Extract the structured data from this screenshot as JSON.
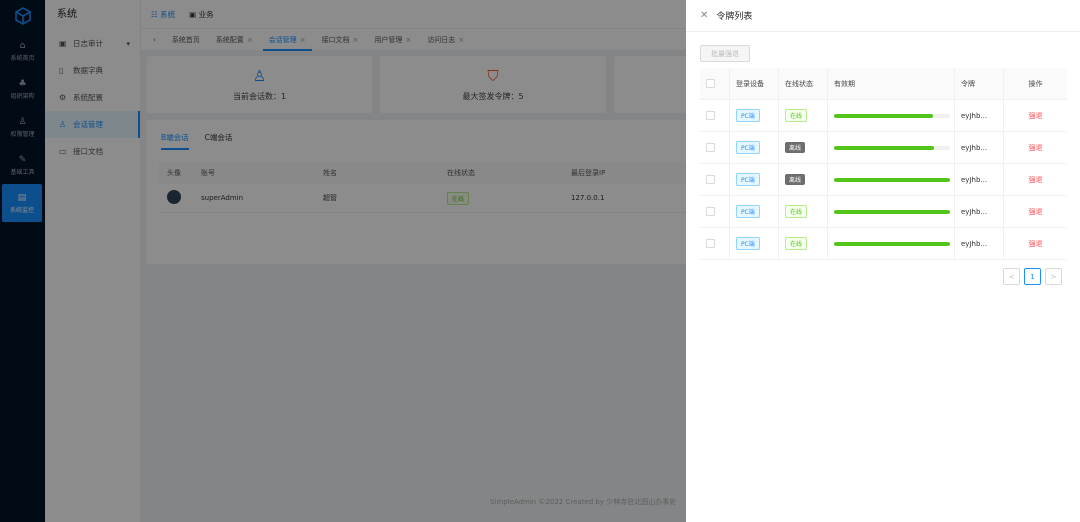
{
  "rail": {
    "items": [
      {
        "label": "系统首页"
      },
      {
        "label": "组织架构"
      },
      {
        "label": "权限管理"
      },
      {
        "label": "基础工具"
      },
      {
        "label": "系统监控"
      }
    ]
  },
  "sidebar": {
    "title": "系统",
    "items": [
      {
        "label": "日志审计"
      },
      {
        "label": "数据字典"
      },
      {
        "label": "系统配置"
      },
      {
        "label": "会话管理"
      },
      {
        "label": "接口文档"
      }
    ]
  },
  "header": {
    "link1": "系统",
    "link2": "业务"
  },
  "tabs": [
    {
      "label": "系统首页"
    },
    {
      "label": "系统配置"
    },
    {
      "label": "会话管理"
    },
    {
      "label": "接口文档"
    },
    {
      "label": "用户管理"
    },
    {
      "label": "访问日志"
    }
  ],
  "cards": {
    "sessions": "当前会话数：1",
    "max_tokens": "最大签发令牌：5"
  },
  "session_tabs": {
    "b": "B端会话",
    "c": "C端会话"
  },
  "session_table": {
    "headers": [
      "头像",
      "账号",
      "姓名",
      "在线状态",
      "最后登录IP"
    ],
    "row": {
      "account": "superAdmin",
      "name": "超管",
      "status": "在线",
      "ip": "127.0.0.1"
    }
  },
  "footer": "SimpleAdmin ©2022 Created by 少林寺驻北固山办事处",
  "drawer": {
    "title": "令牌列表",
    "batch_button": "批量强退",
    "headers": [
      "登录设备",
      "在线状态",
      "有效期",
      "令牌",
      "操作"
    ],
    "rows": [
      {
        "device": "PC端",
        "status": "在线",
        "online": true,
        "validity": 0.85,
        "token": "eyJhb...",
        "action": "强退"
      },
      {
        "device": "PC端",
        "status": "离线",
        "online": false,
        "validity": 0.86,
        "token": "eyJhb...",
        "action": "强退"
      },
      {
        "device": "PC端",
        "status": "离线",
        "online": false,
        "validity": 1.0,
        "token": "eyJhb...",
        "action": "强退"
      },
      {
        "device": "PC端",
        "status": "在线",
        "online": true,
        "validity": 1.0,
        "token": "eyJhb...",
        "action": "强退"
      },
      {
        "device": "PC端",
        "status": "在线",
        "online": true,
        "validity": 1.0,
        "token": "eyJhb...",
        "action": "强退"
      }
    ],
    "pagination": {
      "current": "1",
      "prev": "<",
      "next": ">"
    }
  }
}
